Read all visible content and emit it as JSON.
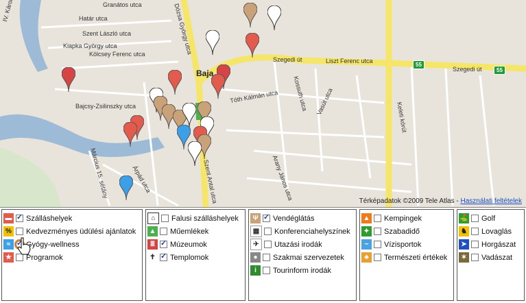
{
  "map": {
    "city_label": "Baja",
    "streets": [
      "Granátos utca",
      "Határ utca",
      "IV. Károly rakpart",
      "Szent László utca",
      "Kiapka György utca",
      "Kölcsey Ferenc utca",
      "Dózsa György utca",
      "Szegedi út",
      "Liszt Ferenc utca",
      "Szegedi út",
      "Bajcsy-Zsilinszky utca",
      "Tóth Kálmán utca",
      "Kossuth utca",
      "Arany János utca",
      "Keleti körút",
      "Szent Antal utca",
      "Március 15. sétány",
      "Vasút utca",
      "Árpád utca"
    ],
    "road_shields": [
      "55",
      "55"
    ],
    "attribution": "Térképadatok ©2009 Tele Atlas",
    "terms_link": "Használati feltételek"
  },
  "columns": [
    {
      "items": [
        {
          "label": "Szálláshelyek",
          "checked": true,
          "icon": "bed-icon",
          "color": "#e25b4d"
        },
        {
          "label": "Kedvezményes üdülési ajánlatok",
          "checked": false,
          "icon": "percent-icon",
          "color": "#f2c200"
        },
        {
          "label": "Gyógy-wellness",
          "checked": true,
          "icon": "water-icon",
          "color": "#3ca0e8"
        },
        {
          "label": "Programok",
          "checked": false,
          "icon": "program-icon",
          "color": "#e25b4d"
        }
      ]
    },
    {
      "items": [
        {
          "label": "Falusi szálláshelyek",
          "checked": false,
          "icon": "house-icon",
          "color": "#ffffff"
        },
        {
          "label": "Műemlékek",
          "checked": false,
          "icon": "monument-icon",
          "color": "#4caf50"
        },
        {
          "label": "Múzeumok",
          "checked": true,
          "icon": "museum-icon",
          "color": "#d64545"
        },
        {
          "label": "Templomok",
          "checked": true,
          "icon": "church-icon",
          "color": "#ffffff"
        }
      ]
    },
    {
      "items": [
        {
          "label": "Vendéglátás",
          "checked": true,
          "icon": "restaurant-icon",
          "color": "#c9a27a"
        },
        {
          "label": "Konferenciahelyszínek",
          "checked": false,
          "icon": "conference-icon",
          "color": "#ffffff"
        },
        {
          "label": "Utazási irodák",
          "checked": false,
          "icon": "travel-icon",
          "color": "#ffffff"
        },
        {
          "label": "Szakmai szervezetek",
          "checked": false,
          "icon": "organization-icon",
          "color": "#888888"
        },
        {
          "label": "Tourinform irodák",
          "checked": false,
          "icon": "info-icon",
          "color": "#2e8b2e"
        }
      ]
    },
    {
      "items": [
        {
          "label": "Kempingek",
          "checked": false,
          "icon": "tent-icon",
          "color": "#f07a1a"
        },
        {
          "label": "Szabadidő",
          "checked": false,
          "icon": "leisure-icon",
          "color": "#2e9c2e"
        },
        {
          "label": "Vízisportok",
          "checked": false,
          "icon": "watersport-icon",
          "color": "#4aa3df"
        },
        {
          "label": "Természeti értékek",
          "checked": false,
          "icon": "nature-icon",
          "color": "#e8a030"
        }
      ]
    },
    {
      "items": [
        {
          "label": "Golf",
          "checked": false,
          "icon": "golf-icon",
          "color": "#2e9c2e"
        },
        {
          "label": "Lovaglás",
          "checked": false,
          "icon": "horse-icon",
          "color": "#f2c200"
        },
        {
          "label": "Horgászat",
          "checked": false,
          "icon": "fishing-icon",
          "color": "#1f4fc1"
        },
        {
          "label": "Vadászat",
          "checked": false,
          "icon": "hunting-icon",
          "color": "#7a6a3a"
        }
      ]
    }
  ]
}
